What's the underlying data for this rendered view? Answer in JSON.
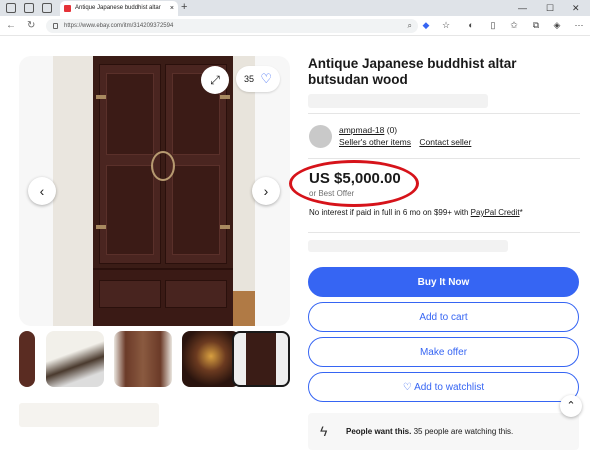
{
  "browser": {
    "tab_title": "Antique Japanese buddhist altar",
    "tab_close": "×",
    "new_tab": "+",
    "url": "https://www.ebay.com/itm/314209372594",
    "window_controls": [
      "—",
      "☐",
      "✕"
    ]
  },
  "gallery": {
    "watch_count": "35",
    "prev_arrow": "‹",
    "next_arrow": "›"
  },
  "listing": {
    "title": "Antique Japanese buddhist altar butsudan wood",
    "seller": {
      "name": "ampmad-18",
      "feedback": "(0)",
      "other_items": "Seller's other items",
      "contact": "Contact seller"
    },
    "price": "US $5,000.00",
    "best_offer": "or Best Offer",
    "interest_text": "No interest if paid in full in 6 mo on $99+ with ",
    "paypal_credit": "PayPal Credit",
    "interest_suffix": "*"
  },
  "actions": {
    "buy_now": "Buy It Now",
    "add_to_cart": "Add to cart",
    "make_offer": "Make offer",
    "add_to_watchlist": "Add to watchlist"
  },
  "social_proof": {
    "bold": "People want this.",
    "text": " 35 people are watching this."
  },
  "colors": {
    "brand_blue": "#3665f3",
    "annotation_red": "#d6131a"
  }
}
